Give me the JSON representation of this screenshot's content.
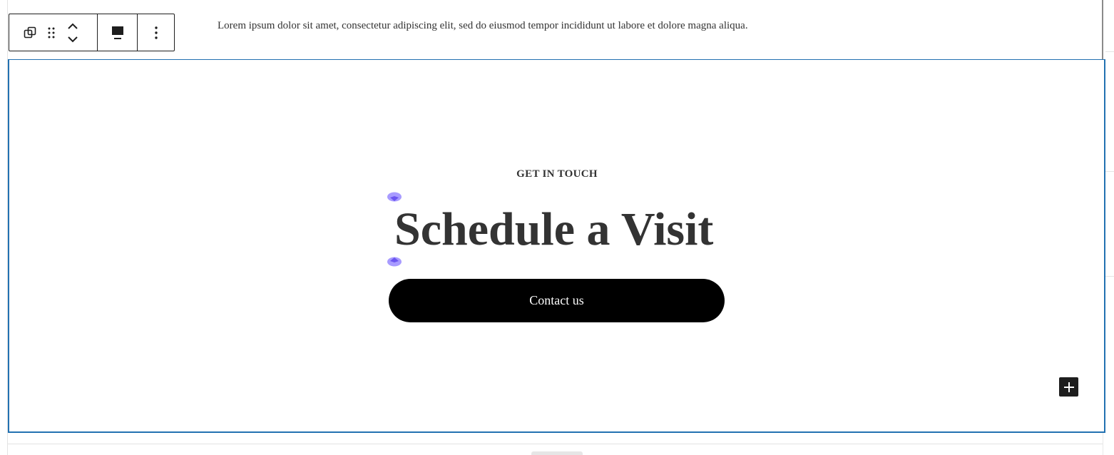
{
  "intro": {
    "text": "Lorem ipsum dolor sit amet, consectetur adipiscing elit, sed do eiusmod tempor incididunt ut labore et dolore magna aliqua."
  },
  "toolbar": {
    "buttons": [
      {
        "icon": "copy-icon"
      },
      {
        "icon": "drag-handle-icon"
      },
      {
        "icon": "move-up-down-icon"
      },
      {
        "icon": "align-icon"
      },
      {
        "icon": "more-options-icon"
      }
    ]
  },
  "cover": {
    "eyebrow": "GET IN TOUCH",
    "heading": "Schedule a Visit",
    "button_label": "Contact us",
    "add_icon": "plus-icon"
  },
  "colors": {
    "selection": "#2271b1",
    "button_bg": "#000000",
    "heading_text": "#333333",
    "caret_handle": "#9b8cff"
  }
}
